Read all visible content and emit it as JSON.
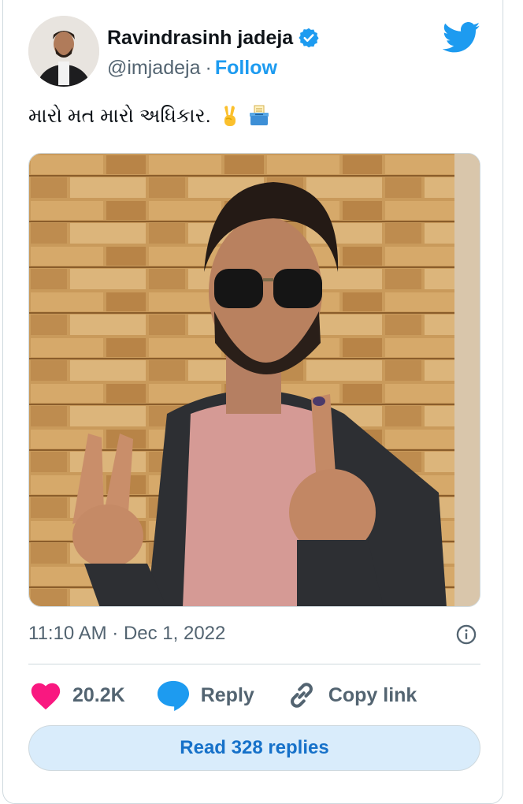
{
  "author": {
    "display_name": "Ravindrasinh jadeja",
    "handle": "@imjadeja",
    "separator": "·",
    "follow_label": "Follow",
    "verified": true
  },
  "tweet": {
    "text": "મારો મત મારો અધિકાર.",
    "emojis": [
      "victory-hand-icon",
      "ballot-box-icon"
    ],
    "timestamp": "11:10 AM · Dec 1, 2022"
  },
  "actions": {
    "likes": "20.2K",
    "reply_label": "Reply",
    "copy_link_label": "Copy link"
  },
  "read_replies_label": "Read 328 replies",
  "colors": {
    "accent": "#1d9bf0",
    "like": "#f91880",
    "text_secondary": "#536471",
    "border": "#cfd9de"
  }
}
